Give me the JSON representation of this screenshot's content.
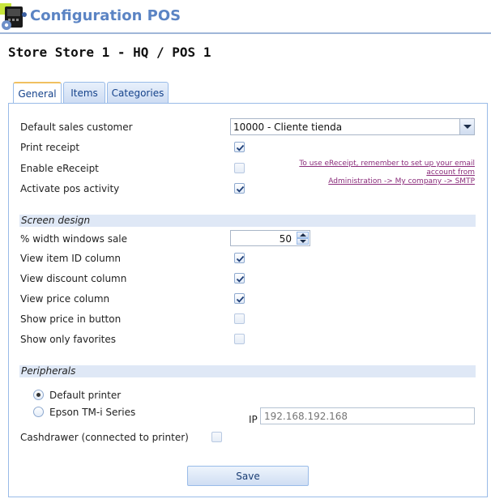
{
  "app": {
    "title": "Configuration POS",
    "logo_icon": "pos-terminal-gear-icon"
  },
  "page": {
    "title": "Store Store 1 - HQ / POS 1"
  },
  "tabs": [
    {
      "label": "General",
      "active": true
    },
    {
      "label": "Items",
      "active": false
    },
    {
      "label": "Categories",
      "active": false
    }
  ],
  "general": {
    "default_sales_customer": {
      "label": "Default sales customer",
      "value": "10000 - Cliente tienda"
    },
    "print_receipt": {
      "label": "Print receipt",
      "checked": true
    },
    "enable_ereceipt": {
      "label": "Enable eReceipt",
      "checked": false,
      "enabled": false,
      "note_line1": "To use eReceipt, remember to set up your email account from",
      "note_line2": "Administration -> My company -> SMTP"
    },
    "activate_pos_activity": {
      "label": "Activate pos activity",
      "checked": true
    }
  },
  "screen_design": {
    "title": "Screen design",
    "width_windows_sale": {
      "label": "% width windows sale",
      "value": "50"
    },
    "view_item_id_column": {
      "label": "View item ID column",
      "checked": true
    },
    "view_discount_column": {
      "label": "View discount column",
      "checked": true
    },
    "view_price_column": {
      "label": "View price column",
      "checked": true
    },
    "show_price_in_button": {
      "label": "Show price in button",
      "checked": false
    },
    "show_only_favorites": {
      "label": "Show only favorites",
      "checked": false
    }
  },
  "peripherals": {
    "title": "Peripherals",
    "printer_options": [
      {
        "label": "Default printer",
        "selected": true
      },
      {
        "label": "Epson TM-i Series",
        "selected": false
      }
    ],
    "ip": {
      "label": "IP",
      "placeholder": "192.168.192.168"
    },
    "cashdrawer": {
      "label": "Cashdrawer (connected to printer)",
      "checked": false
    }
  },
  "actions": {
    "save_label": "Save"
  },
  "colors": {
    "accent": "#5b84c4",
    "border": "#99bbe8",
    "section_bg": "#dfe8f6",
    "note_link": "#8a2b7a"
  }
}
